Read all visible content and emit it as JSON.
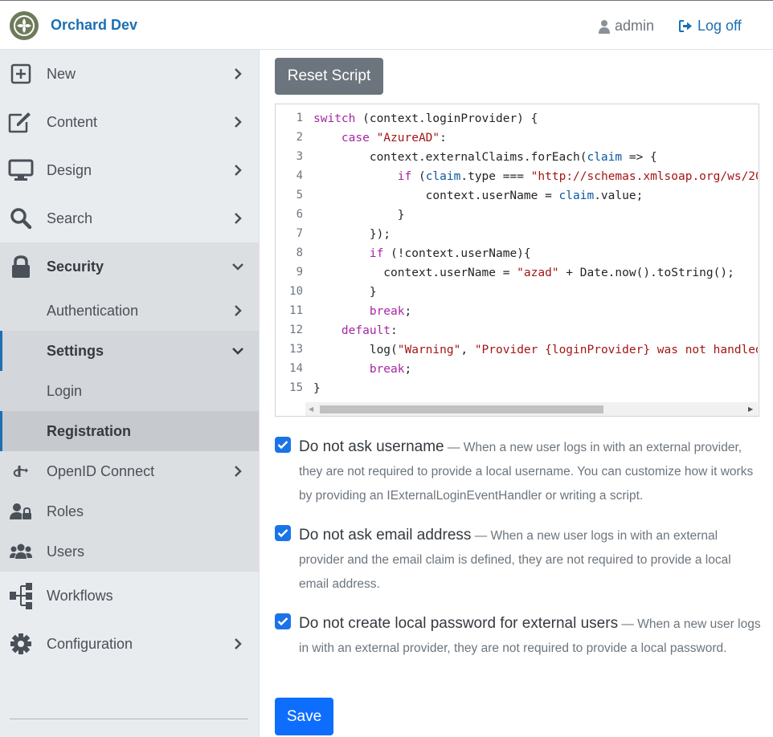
{
  "header": {
    "brand": "Orchard Dev",
    "user": "admin",
    "logoff": "Log off"
  },
  "sidebar": {
    "items": [
      {
        "label": "New",
        "icon": "plus-square-icon"
      },
      {
        "label": "Content",
        "icon": "edit-icon"
      },
      {
        "label": "Design",
        "icon": "desktop-icon"
      },
      {
        "label": "Search",
        "icon": "search-icon"
      },
      {
        "label": "Security",
        "icon": "lock-icon"
      },
      {
        "label": "Authentication"
      },
      {
        "label": "Settings"
      },
      {
        "label": "Login"
      },
      {
        "label": "Registration"
      },
      {
        "label": "OpenID Connect",
        "icon": "openid-icon"
      },
      {
        "label": "Roles",
        "icon": "user-lock-icon"
      },
      {
        "label": "Users",
        "icon": "users-icon"
      },
      {
        "label": "Workflows",
        "icon": "sitemap-icon"
      },
      {
        "label": "Configuration",
        "icon": "cog-icon"
      }
    ]
  },
  "main": {
    "reset_label": "Reset Script",
    "code_lines": [
      "1",
      "2",
      "3",
      "4",
      "5",
      "6",
      "7",
      "8",
      "9",
      "10",
      "11",
      "12",
      "13",
      "14",
      "15"
    ],
    "options": [
      {
        "title": "Do not ask username",
        "desc": " — When a new user logs in with an external provider, they are not required to provide a local username. You can customize how it works by providing an IExternalLoginEventHandler or writing a script."
      },
      {
        "title": "Do not ask email address",
        "desc": " — When a new user logs in with an external provider and the email claim is defined, they are not required to provide a local email address."
      },
      {
        "title": "Do not create local password for external users",
        "desc": " — When a new user logs in with an external provider, they are not required to provide a local password."
      }
    ],
    "save_label": "Save"
  },
  "colors": {
    "accent": "#1b6fb3",
    "primary": "#0d6efd",
    "secondary": "#6c757d"
  }
}
